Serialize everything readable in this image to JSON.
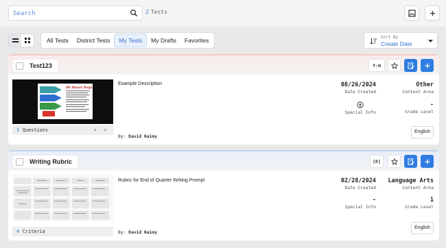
{
  "topbar": {
    "search_placeholder": "Search",
    "test_count": "2",
    "test_count_label": "Tests",
    "icons": [
      "search-icon",
      "image-icon",
      "plus-icon"
    ]
  },
  "toolbar": {
    "view_modes": [
      "list-view-icon",
      "grid-view-icon"
    ],
    "tabs": [
      {
        "label": "All Tests",
        "active": false
      },
      {
        "label": "District Tests",
        "active": false
      },
      {
        "label": "My Tests",
        "active": true
      },
      {
        "label": "My Drafts",
        "active": false
      },
      {
        "label": "Favorites",
        "active": false
      }
    ],
    "sort": {
      "caption": "Sort By",
      "value": "Create Date"
    }
  },
  "tests": [
    {
      "title": "Test123",
      "type_badge": "Y-N",
      "description": "Example Description",
      "author_prefix": "By:",
      "author": "David Naimy",
      "thumb_count": "3",
      "thumb_label": "Questions",
      "thumb_caption": "All About Dogs",
      "date": "08/26/2024",
      "date_label": "Date Created",
      "content_area": "Other",
      "content_area_label": "Content Area",
      "special_info": "",
      "special_info_label": "Special Info",
      "grade_level": "-",
      "grade_level_label": "Grade Level",
      "language": "English"
    },
    {
      "title": "Writing Rubric",
      "type_badge": "[R]",
      "description": "Rubric for End of Quarter Writing Prompt",
      "author_prefix": "By:",
      "author": "David Naimy",
      "thumb_count": "4",
      "thumb_label": "Criteria",
      "date": "02/28/2024",
      "date_label": "Date Created",
      "content_area": "Language Arts",
      "content_area_label": "Content Area",
      "special_info": "-",
      "special_info_label": "Special Info",
      "grade_level": "1",
      "grade_level_label": "Grade Level",
      "language": "English"
    }
  ],
  "colors": {
    "accent": "#2f7de1",
    "link": "#3a7bd5",
    "card1_stripe": "#f3c9c9",
    "card2_stripe": "#bfd3f0"
  }
}
